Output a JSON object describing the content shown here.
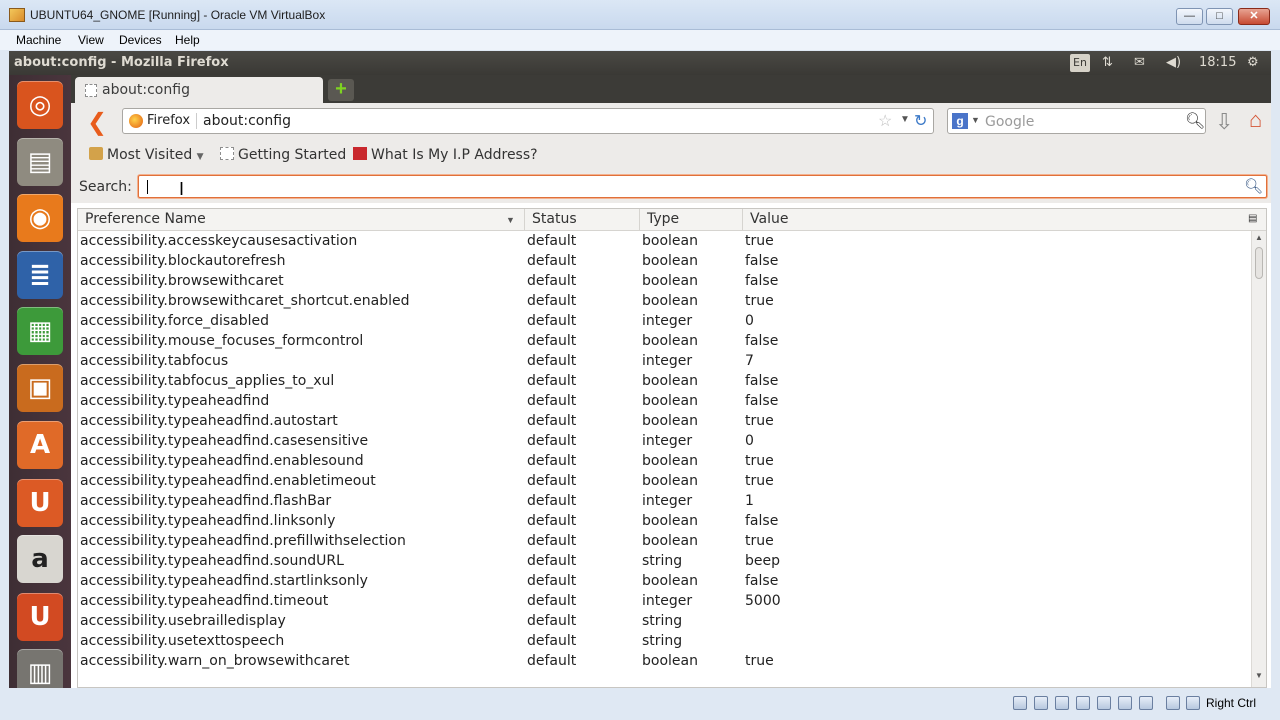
{
  "vbox": {
    "title": "UBUNTU64_GNOME [Running] - Oracle VM VirtualBox",
    "menu": [
      "Machine",
      "View",
      "Devices",
      "Help"
    ],
    "host_key": "Right Ctrl"
  },
  "panel": {
    "window_title": "about:config - Mozilla Firefox",
    "lang": "En",
    "time": "18:15"
  },
  "firefox": {
    "tab_label": "about:config",
    "new_tab_symbol": "+",
    "identity_label": "Firefox",
    "url": "about:config",
    "search_placeholder": "Google",
    "bookmarks": [
      "Most Visited",
      "Getting Started",
      "What Is My I.P Address?"
    ]
  },
  "config": {
    "search_label": "Search:",
    "columns": [
      "Preference Name",
      "Status",
      "Type",
      "Value"
    ],
    "rows": [
      [
        "accessibility.accesskeycausesactivation",
        "default",
        "boolean",
        "true"
      ],
      [
        "accessibility.blockautorefresh",
        "default",
        "boolean",
        "false"
      ],
      [
        "accessibility.browsewithcaret",
        "default",
        "boolean",
        "false"
      ],
      [
        "accessibility.browsewithcaret_shortcut.enabled",
        "default",
        "boolean",
        "true"
      ],
      [
        "accessibility.force_disabled",
        "default",
        "integer",
        "0"
      ],
      [
        "accessibility.mouse_focuses_formcontrol",
        "default",
        "boolean",
        "false"
      ],
      [
        "accessibility.tabfocus",
        "default",
        "integer",
        "7"
      ],
      [
        "accessibility.tabfocus_applies_to_xul",
        "default",
        "boolean",
        "false"
      ],
      [
        "accessibility.typeaheadfind",
        "default",
        "boolean",
        "false"
      ],
      [
        "accessibility.typeaheadfind.autostart",
        "default",
        "boolean",
        "true"
      ],
      [
        "accessibility.typeaheadfind.casesensitive",
        "default",
        "integer",
        "0"
      ],
      [
        "accessibility.typeaheadfind.enablesound",
        "default",
        "boolean",
        "true"
      ],
      [
        "accessibility.typeaheadfind.enabletimeout",
        "default",
        "boolean",
        "true"
      ],
      [
        "accessibility.typeaheadfind.flashBar",
        "default",
        "integer",
        "1"
      ],
      [
        "accessibility.typeaheadfind.linksonly",
        "default",
        "boolean",
        "false"
      ],
      [
        "accessibility.typeaheadfind.prefillwithselection",
        "default",
        "boolean",
        "true"
      ],
      [
        "accessibility.typeaheadfind.soundURL",
        "default",
        "string",
        "beep"
      ],
      [
        "accessibility.typeaheadfind.startlinksonly",
        "default",
        "boolean",
        "false"
      ],
      [
        "accessibility.typeaheadfind.timeout",
        "default",
        "integer",
        "5000"
      ],
      [
        "accessibility.usebrailledisplay",
        "default",
        "string",
        ""
      ],
      [
        "accessibility.usetexttospeech",
        "default",
        "string",
        ""
      ],
      [
        "accessibility.warn_on_browsewithcaret",
        "default",
        "boolean",
        "true"
      ]
    ]
  },
  "launcher": [
    {
      "name": "ubuntu-dash-icon",
      "glyph": "◎",
      "color": "#d9541e"
    },
    {
      "name": "files-icon",
      "glyph": "▤",
      "color": "#8f8b80"
    },
    {
      "name": "firefox-icon",
      "glyph": "◉",
      "color": "#e87a1c"
    },
    {
      "name": "writer-icon",
      "glyph": "≣",
      "color": "#2f62a8"
    },
    {
      "name": "calc-icon",
      "glyph": "▦",
      "color": "#3d9a3a"
    },
    {
      "name": "impress-icon",
      "glyph": "▣",
      "color": "#c96b1e"
    },
    {
      "name": "software-center-icon",
      "glyph": "A",
      "color": "#e06a28"
    },
    {
      "name": "ubuntu-one-icon",
      "glyph": "U",
      "color": "#dc5a25"
    },
    {
      "name": "amazon-icon",
      "glyph": "a",
      "color": "#d8d6d0"
    },
    {
      "name": "ubuntu-one-music-icon",
      "glyph": "U",
      "color": "#d24a22"
    },
    {
      "name": "workspace-switcher-icon",
      "glyph": "▥",
      "color": "#777570"
    }
  ]
}
